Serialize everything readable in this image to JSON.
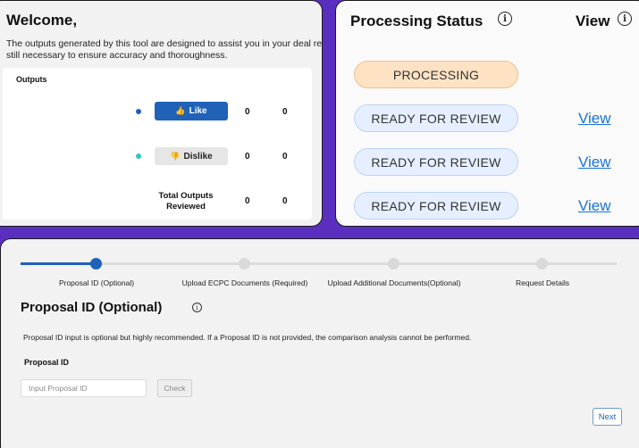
{
  "welcome": {
    "title": "Welcome,",
    "description_line1": "The outputs generated by this tool are designed to assist you in your deal re",
    "description_line2": "still necessary to ensure accuracy and thoroughness.",
    "outputs_label": "Outputs",
    "like_label": "Like",
    "like_icon": "thumbs-up-icon",
    "like_icon_glyph": "👍",
    "like_dot_color": "#1f62b8",
    "like_count_1": "0",
    "like_count_2": "0",
    "dislike_label": "Dislike",
    "dislike_icon": "thumbs-down-icon",
    "dislike_icon_glyph": "👎",
    "dislike_dot_color": "#2fc4c4",
    "dislike_count_1": "0",
    "dislike_count_2": "0",
    "total_label_line1": "Total Outputs",
    "total_label_line2": "Reviewed",
    "total_count_1": "0",
    "total_count_2": "0"
  },
  "processing": {
    "title": "Processing Status",
    "view_header": "View",
    "info_glyph": "i",
    "rows": [
      {
        "status": "PROCESSING",
        "view": ""
      },
      {
        "status": "READY FOR REVIEW",
        "view": "View"
      },
      {
        "status": "READY FOR REVIEW",
        "view": "View"
      },
      {
        "status": "READY FOR REVIEW",
        "view": "View"
      }
    ],
    "processing_color": "#fde3c4",
    "ready_color": "#e6efff",
    "link_color": "#1a73d9"
  },
  "proposal": {
    "steps": [
      "Proposal ID (Optional)",
      "Upload ECPC Documents (Required)",
      "Upload Additional Documents(Optional)",
      "Request Details"
    ],
    "active_step": 0,
    "title": "Proposal ID (Optional)",
    "info_glyph": "i",
    "description": "Proposal ID input is optional but highly recommended. If a Proposal ID is not provided, the comparison analysis cannot be performed.",
    "field_label": "Proposal ID",
    "input_value": "",
    "input_placeholder": "Input Proposal ID",
    "check_label": "Check",
    "next_label": "Next",
    "accent_color": "#1f62b8"
  }
}
